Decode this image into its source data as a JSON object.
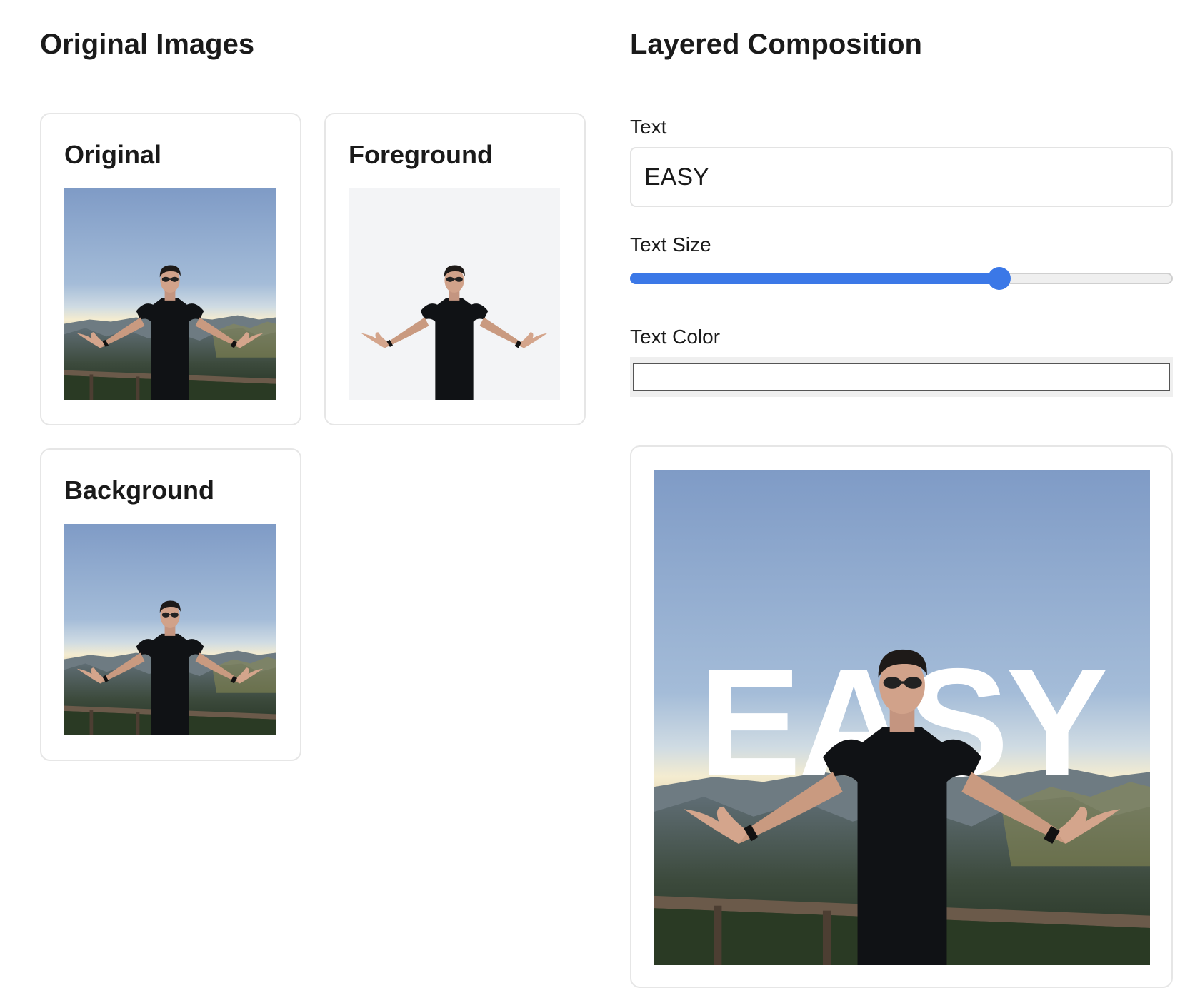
{
  "left_section": {
    "title": "Original Images"
  },
  "right_section": {
    "title": "Layered Composition"
  },
  "cards": {
    "original": {
      "title": "Original"
    },
    "foreground": {
      "title": "Foreground"
    },
    "background": {
      "title": "Background"
    }
  },
  "controls": {
    "text_label": "Text",
    "text_value": "EASY",
    "size_label": "Text Size",
    "size_value_fraction": 0.68,
    "color_label": "Text Color",
    "color_value": "#ffffff"
  },
  "composition": {
    "overlay_text": "EASY"
  },
  "colors": {
    "accent": "#3b78e7",
    "foreground_bg": "#f3f4f6"
  }
}
